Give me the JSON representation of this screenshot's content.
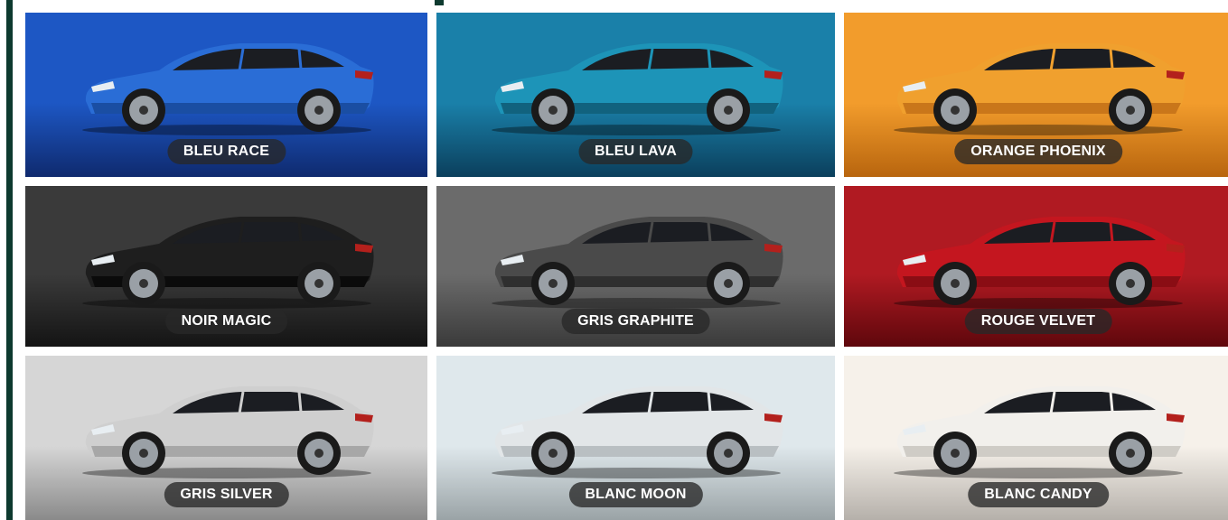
{
  "colors": [
    {
      "label": "BLEU RACE",
      "bg_top": "#1d57c4",
      "bg_bottom": "#0f2a6e",
      "body": "#2a6dd6",
      "shade": "#1a4ea3"
    },
    {
      "label": "BLEU LAVA",
      "bg_top": "#1a80a9",
      "bg_bottom": "#0b3f5c",
      "body": "#1d94b8",
      "shade": "#11627e"
    },
    {
      "label": "ORANGE PHOENIX",
      "bg_top": "#f29c2c",
      "bg_bottom": "#b8650e",
      "body": "#f0a02e",
      "shade": "#c9761a"
    },
    {
      "label": "NOIR MAGIC",
      "bg_top": "#3a3a3a",
      "bg_bottom": "#141414",
      "body": "#1e1e1e",
      "shade": "#0b0b0b"
    },
    {
      "label": "GRIS GRAPHITE",
      "bg_top": "#6b6b6b",
      "bg_bottom": "#3a3a3a",
      "body": "#4a4a4a",
      "shade": "#2f2f2f"
    },
    {
      "label": "ROUGE VELVET",
      "bg_top": "#b01a22",
      "bg_bottom": "#5e070c",
      "body": "#c4161f",
      "shade": "#8a0d14"
    },
    {
      "label": "GRIS SILVER",
      "bg_top": "#d6d6d6",
      "bg_bottom": "#8a8a8a",
      "body": "#cfcfcf",
      "shade": "#a7a7a7"
    },
    {
      "label": "BLANC MOON",
      "bg_top": "#dfe8ec",
      "bg_bottom": "#9aa3a6",
      "body": "#e2e6e8",
      "shade": "#b9bfc2"
    },
    {
      "label": "BLANC CANDY",
      "bg_top": "#f6f1ea",
      "bg_bottom": "#b5b0aa",
      "body": "#f2f0ec",
      "shade": "#cfccc6"
    }
  ],
  "accent": "#0e3a2f"
}
